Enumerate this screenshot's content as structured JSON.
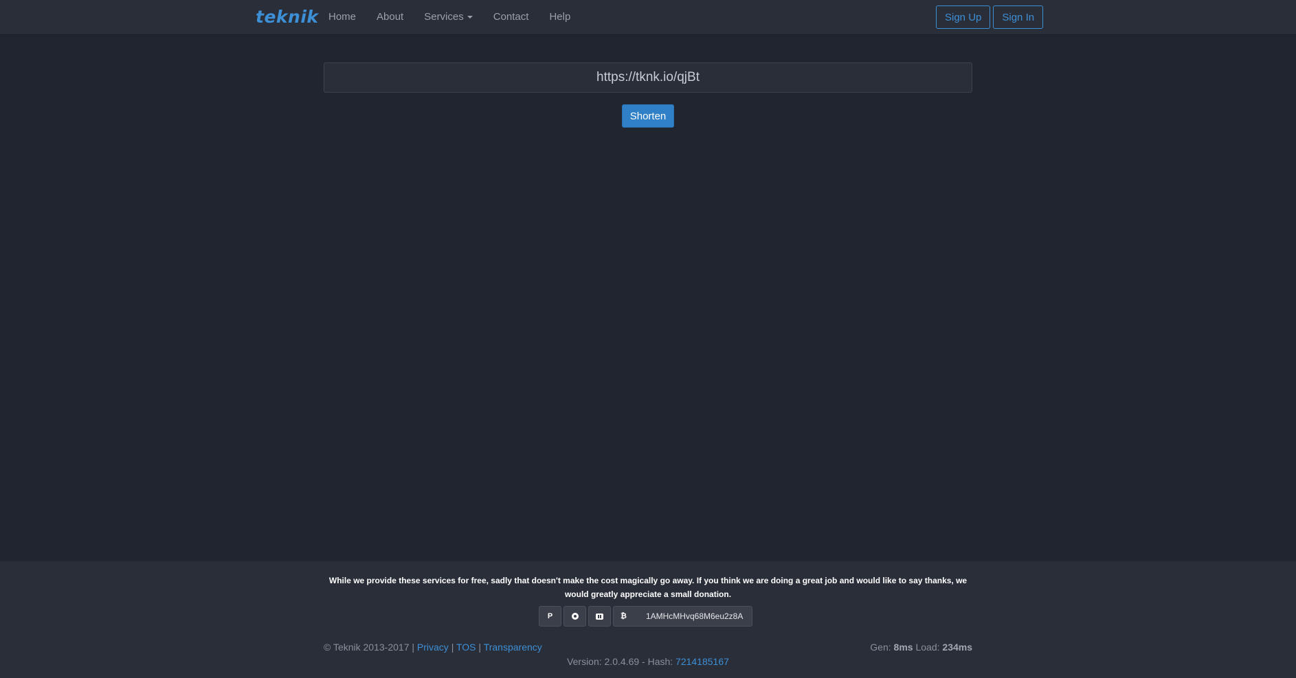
{
  "navbar": {
    "brand": "teknik",
    "links": [
      "Home",
      "About",
      "Services",
      "Contact",
      "Help"
    ],
    "sign_up": "Sign Up",
    "sign_in": "Sign In"
  },
  "shortener": {
    "url_value": "https://tknk.io/qjBt",
    "button_label": "Shorten"
  },
  "footer": {
    "donate_message": "While we provide these services for free, sadly that doesn't make the cost magically go away. If you think we are doing a great job and would like to say thanks, we would greatly appreciate a small donation.",
    "donate_icons": [
      "paypal-icon",
      "circle-icon",
      "bars-icon",
      "bitcoin-icon"
    ],
    "bitcoin_address": "1AMHcMHvq68M6eu2z8A",
    "copyright": "© Teknik 2013-2017 |",
    "links": {
      "privacy": "Privacy",
      "tos": "TOS",
      "transparency": "Transparency"
    },
    "separator": "|",
    "stats": {
      "gen_label": "Gen:",
      "gen_value": "8ms",
      "load_label": "Load:",
      "load_value": "234ms"
    },
    "version_label": "Version: 2.0.4.69 - Hash:",
    "hash": "7214185167"
  },
  "colors": {
    "background": "#21252f",
    "navbar": "#2a2e39",
    "accent": "#3d8fd6",
    "primary_button": "#3080c8"
  }
}
